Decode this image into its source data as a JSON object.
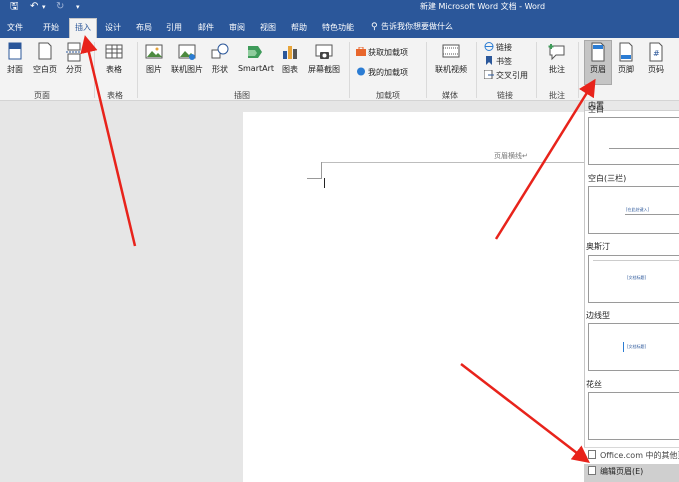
{
  "titlebar": {
    "title": "新建 Microsoft Word 文档 - Word",
    "quick_access": {
      "save": "🖫",
      "undo": "↶",
      "undo_more": "▾",
      "redo": "↻",
      "customize": "▾"
    },
    "bg_color": "#2b579a"
  },
  "tabs": [
    {
      "label": "文件"
    },
    {
      "label": "开始"
    },
    {
      "label": "插入",
      "active": true
    },
    {
      "label": "设计"
    },
    {
      "label": "布局"
    },
    {
      "label": "引用"
    },
    {
      "label": "邮件"
    },
    {
      "label": "审阅"
    },
    {
      "label": "视图"
    },
    {
      "label": "帮助"
    },
    {
      "label": "特色功能"
    }
  ],
  "tell_me": {
    "icon": "lightbulb-icon",
    "text": "告诉我你想要做什么"
  },
  "ribbon": {
    "buttons": {
      "cover": "封面",
      "blank_page": "空白页",
      "page_break": "分页",
      "table": "表格",
      "picture": "图片",
      "online_picture": "联机图片",
      "shapes": "形状",
      "smartart": "SmartArt",
      "chart": "图表",
      "screenshot": "屏幕截图",
      "get_addins": "获取加载项",
      "my_addins": "我的加载项",
      "online_video": "联机视频",
      "link": "链接",
      "bookmark": "书签",
      "cross_ref": "交叉引用",
      "comment": "批注",
      "header": "页眉",
      "footer": "页脚",
      "page_number": "页码"
    },
    "groups": {
      "pages": "页面",
      "tables": "表格",
      "illustrations": "插图",
      "addins": "加载项",
      "media": "媒体",
      "links": "链接",
      "comments": "批注"
    }
  },
  "document": {
    "header_label": "页眉横线↵"
  },
  "gallery": {
    "section": "内置",
    "items": [
      {
        "name": "空白"
      },
      {
        "name": "空白(三栏)",
        "placeholder": "[在此处键入]"
      },
      {
        "name": "奥斯汀",
        "placeholder": "[文档标题]"
      },
      {
        "name": "边线型",
        "placeholder": "[文档标题]"
      },
      {
        "name": "花丝"
      }
    ],
    "more_office": "Office.com 中的其他页眉(M)",
    "edit_header": "编辑页眉(E)"
  },
  "annotations": {
    "arrow_color": "#e8231b"
  }
}
